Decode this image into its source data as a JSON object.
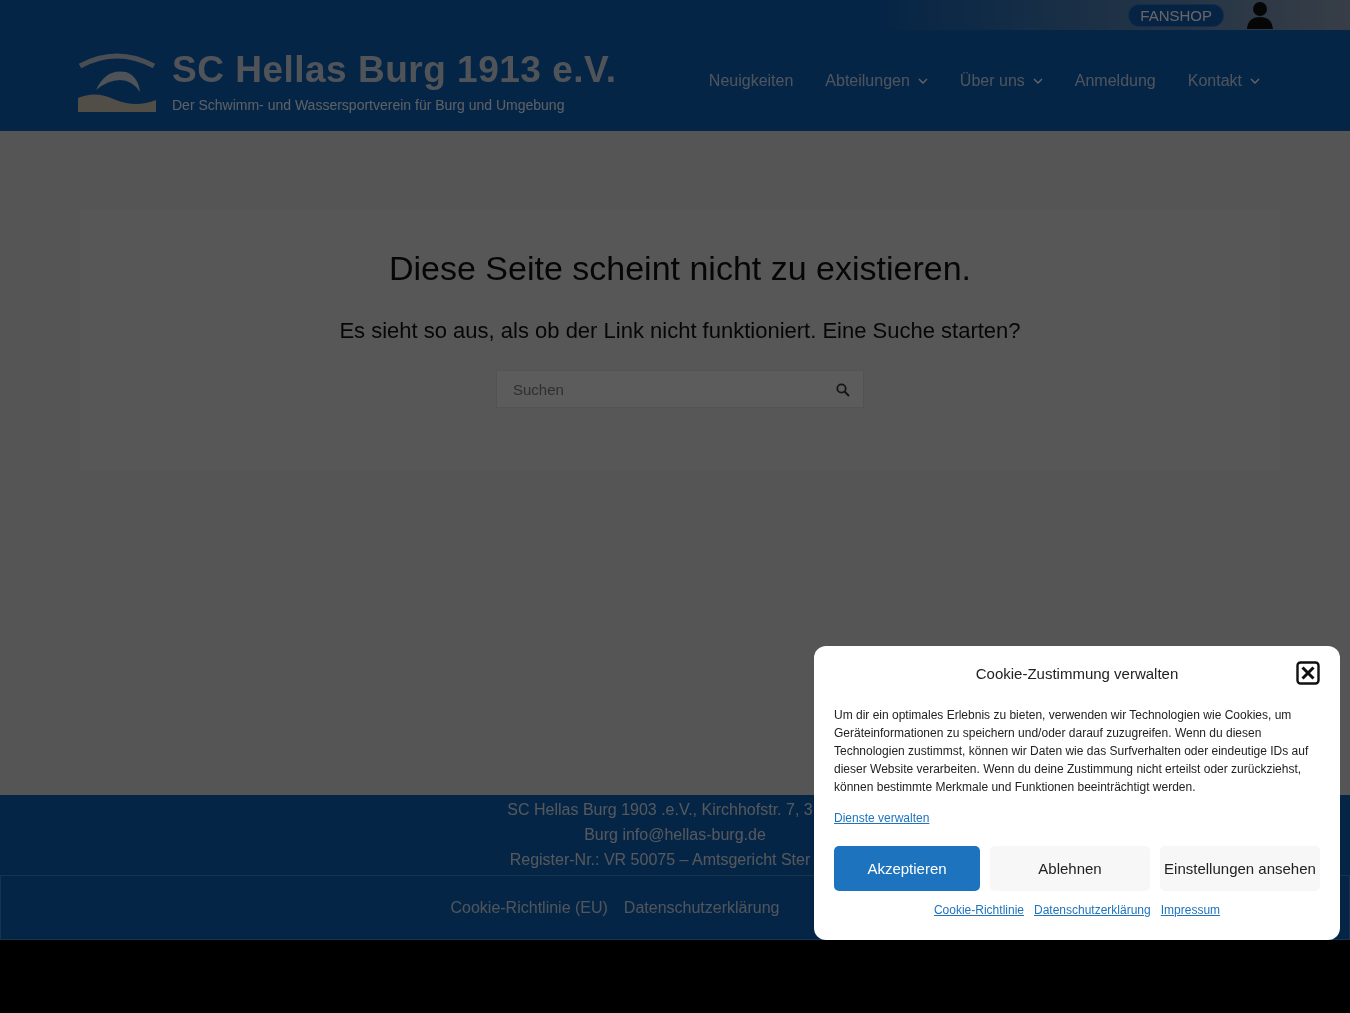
{
  "topbar": {
    "fanshop": "FANSHOP"
  },
  "header": {
    "title": "SC Hellas Burg 1913 e.V.",
    "tagline": "Der Schwimm- und Wassersportverein für Burg und Umgebung"
  },
  "nav": [
    {
      "label": "Neuigkeiten",
      "dropdown": false
    },
    {
      "label": "Abteilungen",
      "dropdown": true
    },
    {
      "label": "Über uns",
      "dropdown": true
    },
    {
      "label": "Anmeldung",
      "dropdown": false
    },
    {
      "label": "Kontakt",
      "dropdown": true
    }
  ],
  "content": {
    "heading": "Diese Seite scheint nicht zu existieren.",
    "text": "Es sieht so aus, als ob der Link nicht funktioniert. Eine Suche starten?",
    "search": {
      "placeholder": "Suchen"
    }
  },
  "footer": {
    "lines": [
      "SC Hellas Burg 1903 .e.V., Kirchhofstr. 7, 3",
      "Burg info@hellas-burg.de",
      "Register-Nr.: VR 50075 – Amtsgericht Ster"
    ],
    "links": [
      "Cookie-Richtlinie (EU)",
      "Datenschutzerklärung"
    ]
  },
  "cookie_dialog": {
    "title": "Cookie-Zustimmung verwalten",
    "text": "Um dir ein optimales Erlebnis zu bieten, verwenden wir Technologien wie Cookies, um Geräteinformationen zu speichern und/oder darauf zuzugreifen. Wenn du diesen Technologien zustimmst, können wir Daten wie das Surfverhalten oder eindeutige IDs auf dieser Website verarbeiten. Wenn du deine Zustimmung nicht erteilst oder zurückziehst, können bestimmte Merkmale und Funktionen beeinträchtigt werden.",
    "manage_link": "Dienste verwalten",
    "buttons": [
      {
        "label": "Akzeptieren",
        "kind": "primary"
      },
      {
        "label": "Ablehnen",
        "kind": "secondary"
      },
      {
        "label": "Einstellungen ansehen",
        "kind": "secondary"
      }
    ],
    "links": [
      "Cookie-Richtlinie",
      "Datenschutzerklärung",
      "Impressum"
    ]
  }
}
